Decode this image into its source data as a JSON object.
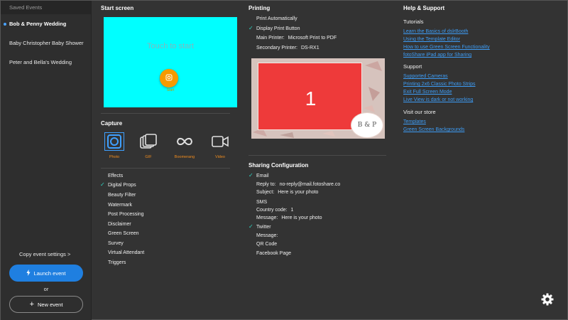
{
  "sidebar": {
    "header": "Saved Events",
    "events": [
      {
        "label": "Bob & Penny Wedding",
        "active": true
      },
      {
        "label": "Baby Christopher Baby Shower",
        "active": false
      },
      {
        "label": "Peter and Bella's Wedding",
        "active": false
      }
    ],
    "copy_settings": "Copy event settings >",
    "launch_label": "Launch event",
    "or_label": "or",
    "new_event_label": "New event"
  },
  "start_screen": {
    "title": "Start screen",
    "touch_text": "Touch to start",
    "button_label": "Start"
  },
  "capture": {
    "title": "Capture",
    "modes": [
      {
        "label": "Photo",
        "icon": "camera-icon",
        "selected": true
      },
      {
        "label": "GIF",
        "icon": "gif-stack-icon",
        "selected": false
      },
      {
        "label": "Boomerang",
        "icon": "infinity-icon",
        "selected": false
      },
      {
        "label": "Video",
        "icon": "video-camera-icon",
        "selected": false
      }
    ],
    "features": [
      {
        "label": "Effects",
        "checked": false
      },
      {
        "label": "Digital Props",
        "checked": true
      },
      {
        "label": "Beauty Filter",
        "checked": false
      },
      {
        "label": "Watermark",
        "checked": false
      },
      {
        "label": "Post Processing",
        "checked": false
      },
      {
        "label": "Disclaimer",
        "checked": false
      },
      {
        "label": "Green Screen",
        "checked": false
      },
      {
        "label": "Survey",
        "checked": false
      },
      {
        "label": "Virtual Attendant",
        "checked": false
      },
      {
        "label": "Triggers",
        "checked": false
      }
    ]
  },
  "printing": {
    "title": "Printing",
    "print_auto": "Print Automatically",
    "display_print_button": "Display Print Button",
    "main_printer_label": "Main Printer:",
    "main_printer_value": "Microsoft Print to PDF",
    "secondary_printer_label": "Secondary Printer:",
    "secondary_printer_value": "DS-RX1",
    "preview_number": "1",
    "monogram": "B & P"
  },
  "sharing": {
    "title": "Sharing Configuration",
    "email_label": "Email",
    "reply_to_label": "Reply to:",
    "reply_to_value": "no-reply@mail.fotoshare.co",
    "subject_label": "Subject:",
    "subject_value": "Here is your photo",
    "sms_label": "SMS",
    "country_code_label": "Country code:",
    "country_code_value": "1",
    "sms_message_label": "Message:",
    "sms_message_value": "Here is your photo",
    "twitter_label": "Twitter",
    "twitter_message_label": "Message:",
    "qr_code_label": "QR Code",
    "facebook_label": "Facebook Page"
  },
  "help": {
    "title": "Help & Support",
    "tutorials_title": "Tutorials",
    "tutorials": [
      "Learn the Basics of dslrBooth",
      "Using the Template Editor",
      "How to use Green Screen Functionality",
      "fotoShare iPad app for Sharing"
    ],
    "support_title": "Support",
    "support": [
      "Supported Cameras",
      "Printing 2x6 Classic Photo Strips",
      "Exit Full Screen Mode",
      "Live View is dark or not working"
    ],
    "store_title": "Visit our store",
    "store": [
      "Templates",
      "Green Screen Backgrounds"
    ]
  },
  "colors": {
    "accent_blue": "#1f7fe0",
    "link_blue": "#3d9cf5",
    "check_teal": "#2fd6c3",
    "capture_orange": "#f08c1e",
    "start_bg": "#00ffff",
    "start_button": "#f59a00",
    "print_red": "#ee3a3a"
  }
}
